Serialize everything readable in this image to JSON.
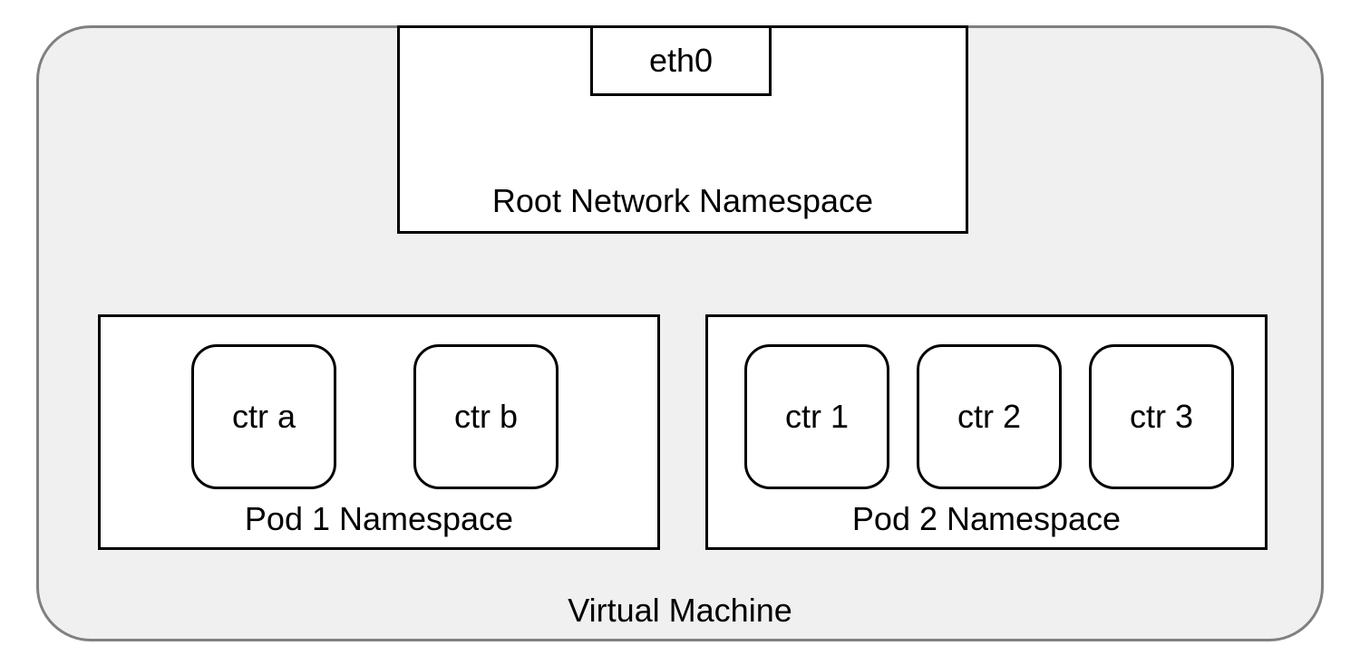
{
  "vm": {
    "label": "Virtual Machine"
  },
  "root_ns": {
    "label": "Root Network Namespace",
    "eth0": "eth0"
  },
  "pod1": {
    "label": "Pod 1 Namespace",
    "containers": {
      "a": "ctr a",
      "b": "ctr b"
    }
  },
  "pod2": {
    "label": "Pod 2 Namespace",
    "containers": {
      "c1": "ctr 1",
      "c2": "ctr 2",
      "c3": "ctr 3"
    }
  }
}
